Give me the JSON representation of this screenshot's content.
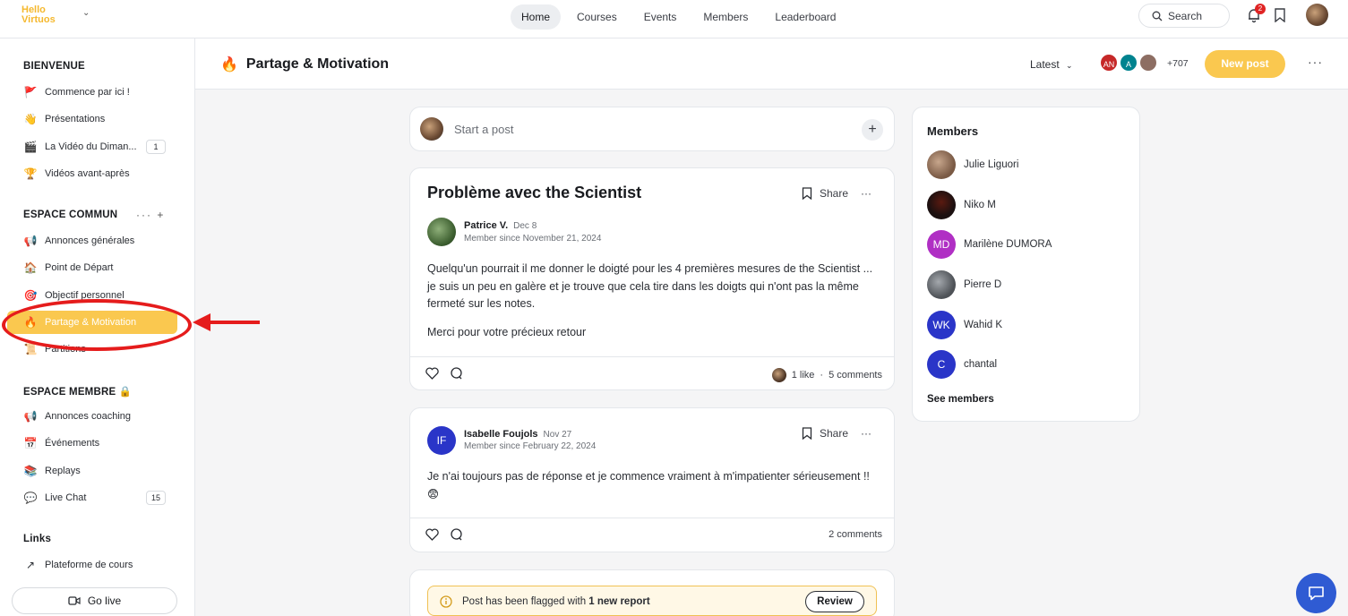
{
  "topbar": {
    "logo_line1": "Hello",
    "logo_line2": "Virtuos",
    "nav": [
      "Home",
      "Courses",
      "Events",
      "Members",
      "Leaderboard"
    ],
    "search_label": "Search",
    "notification_count": "2"
  },
  "sidebar": {
    "bienvenue_title": "BIENVENUE",
    "bienvenue_items": [
      {
        "icon": "🚩",
        "label": "Commence par ici !"
      },
      {
        "icon": "👋",
        "label": "Présentations"
      },
      {
        "icon": "🎬",
        "label": "La Vidéo du Diman...",
        "count": "1"
      },
      {
        "icon": "🏆",
        "label": "Vidéos avant-après"
      }
    ],
    "commun_title": "ESPACE COMMUN",
    "commun_items": [
      {
        "icon": "📢",
        "label": "Annonces générales"
      },
      {
        "icon": "🏠",
        "label": "Point de Départ"
      },
      {
        "icon": "🎯",
        "label": "Objectif personnel"
      },
      {
        "icon": "🔥",
        "label": "Partage & Motivation"
      },
      {
        "icon": "📜",
        "label": "Partitions"
      }
    ],
    "membre_title": "ESPACE MEMBRE 🔒",
    "membre_items": [
      {
        "icon": "📢",
        "label": "Annonces coaching"
      },
      {
        "icon": "📅",
        "label": "Événements"
      },
      {
        "icon": "📚",
        "label": "Replays"
      },
      {
        "icon": "💬",
        "label": "Live Chat",
        "count": "15"
      }
    ],
    "links_title": "Links",
    "links_items": [
      {
        "icon": "↗",
        "label": "Plateforme de cours"
      }
    ],
    "golive_label": "Go live"
  },
  "header": {
    "icon": "🔥",
    "title": "Partage & Motivation",
    "sort_label": "Latest",
    "avatars": [
      {
        "initials": "AN",
        "color": "#c62828"
      },
      {
        "initials": "A",
        "color": "#00838f"
      },
      {
        "initials": "",
        "color": "#8d6e63"
      }
    ],
    "extra_count": "+707",
    "new_post_label": "New post"
  },
  "composer": {
    "placeholder": "Start a post"
  },
  "posts": [
    {
      "title": "Problème avec the Scientist",
      "share_label": "Share",
      "author": "Patrice V.",
      "date": "Dec 8",
      "member_since": "Member since November 21, 2024",
      "body_p1": "Quelqu'un pourrait il me donner le doigté pour les 4 premières mesures de the Scientist ...  je suis un peu en galère et je trouve que cela tire dans les doigts qui n'ont pas la même fermeté sur les notes.",
      "body_p2": "Merci pour votre précieux retour",
      "likes": "1 like",
      "comments": "5 comments"
    },
    {
      "share_label": "Share",
      "author_initials": "IF",
      "author": "Isabelle Foujols",
      "date": "Nov 27",
      "member_since": "Member since February 22, 2024",
      "body_p1": "Je n'ai toujours pas de réponse et je commence vraiment à m'impatienter sérieusement !!😨",
      "comments": "2 comments"
    }
  ],
  "flagged": {
    "text_prefix": "Post has been flagged with ",
    "text_strong": "1 new report",
    "review_label": "Review"
  },
  "members": {
    "title": "Members",
    "list": [
      {
        "name": "Julie Liguori",
        "initials": "",
        "color": "#9a7b65"
      },
      {
        "name": "Niko M",
        "initials": "",
        "color": "#1b1010"
      },
      {
        "name": "Marilène DUMORA",
        "initials": "MD",
        "color": "#b02fc4"
      },
      {
        "name": "Pierre D",
        "initials": "",
        "color": "#6b6f76"
      },
      {
        "name": "Wahid K",
        "initials": "WK",
        "color": "#2a35c8"
      },
      {
        "name": "chantal",
        "initials": "C",
        "color": "#2a35c8"
      }
    ],
    "see_members": "See members"
  }
}
